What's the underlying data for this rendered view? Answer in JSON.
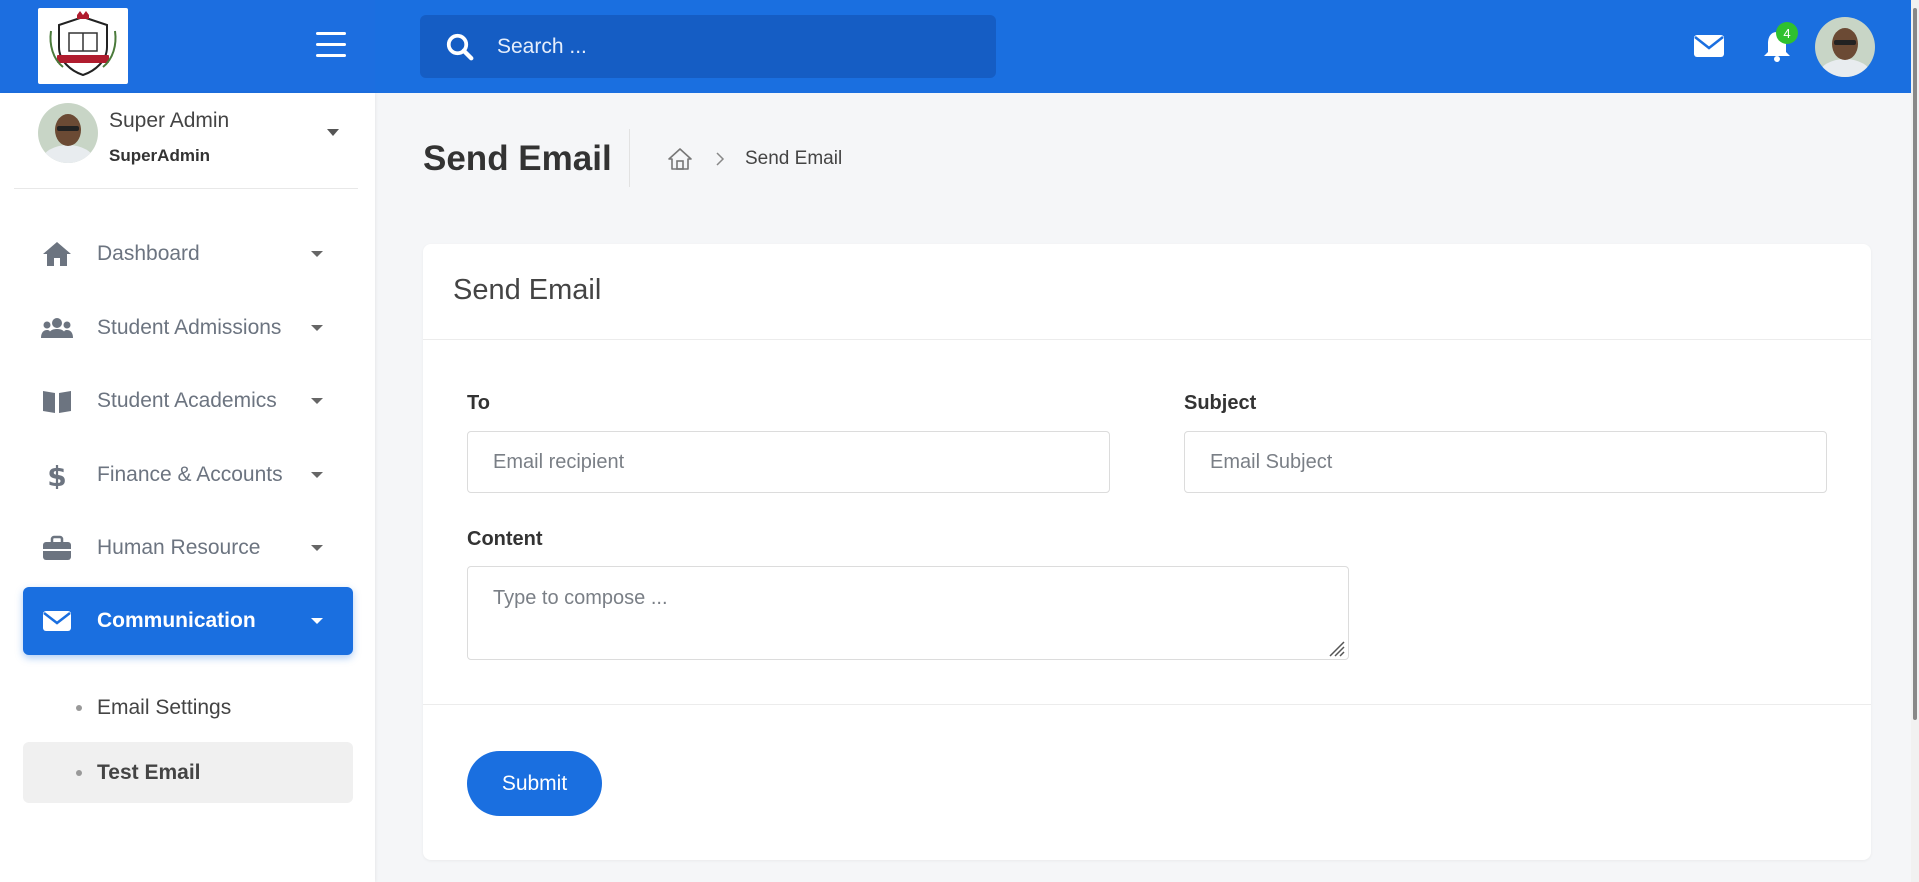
{
  "header": {
    "search_placeholder": "Search ...",
    "notification_count": "4"
  },
  "sidebar": {
    "user_name": "Super Admin",
    "user_role": "SuperAdmin",
    "items": [
      {
        "label": "Dashboard",
        "icon": "home-icon"
      },
      {
        "label": "Student Admissions",
        "icon": "users-icon"
      },
      {
        "label": "Student Academics",
        "icon": "book-icon"
      },
      {
        "label": "Finance & Accounts",
        "icon": "dollar-icon"
      },
      {
        "label": "Human Resource",
        "icon": "briefcase-icon"
      },
      {
        "label": "Communication",
        "icon": "envelope-icon"
      }
    ],
    "sub_items": [
      {
        "label": "Email Settings"
      },
      {
        "label": "Test Email"
      }
    ]
  },
  "main": {
    "page_title": "Send Email",
    "breadcrumb_current": "Send Email",
    "card_title": "Send Email",
    "to_label": "To",
    "to_placeholder": "Email recipient",
    "subject_label": "Subject",
    "subject_placeholder": "Email Subject",
    "content_label": "Content",
    "content_placeholder": "Type to compose ...",
    "submit_label": "Submit"
  },
  "colors": {
    "accent": "#1a6fe0",
    "badge": "#2fc12f"
  }
}
